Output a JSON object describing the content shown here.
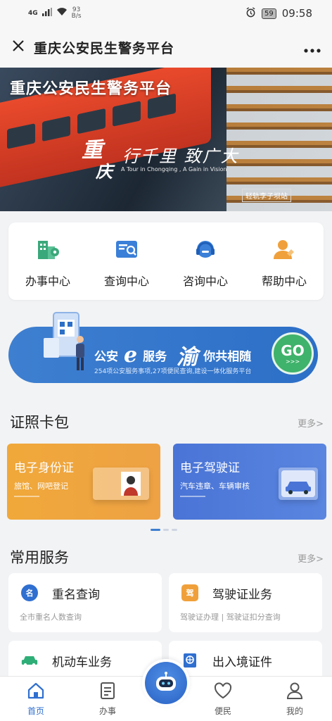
{
  "status": {
    "signal": "4G",
    "net_speed_value": "93",
    "net_speed_unit": "B/s",
    "battery": "59",
    "time": "09:58"
  },
  "navbar": {
    "title": "重庆公安民生警务平台"
  },
  "banner": {
    "title": "重庆公安民生警务平台",
    "calli_1": "重",
    "calli_2": "庆",
    "slogan": "行千里 致广大",
    "slogan_en": "A Tour in Chongqing , A Gain in Vision",
    "station": "轻轨李子坝站"
  },
  "quick": [
    {
      "label": "办事中心",
      "icon": "building-pin-icon",
      "color": "#3aa87a"
    },
    {
      "label": "查询中心",
      "icon": "search-doc-icon",
      "color": "#3a7fd8"
    },
    {
      "label": "咨询中心",
      "icon": "headset-icon",
      "color": "#3a7fd8"
    },
    {
      "label": "帮助中心",
      "icon": "helper-icon",
      "color": "#f0a03a"
    }
  ],
  "promo": {
    "part1": "公安",
    "e": "e",
    "part2": "服务",
    "yu": "渝",
    "part3": "你共相随",
    "sub": "254项公安服务事项,27项便民查询,建设一体化服务平台",
    "go": "GO",
    "go_arrow": ">>>"
  },
  "wallet": {
    "title": "证照卡包",
    "more": "更多>",
    "cards": [
      {
        "title": "电子身份证",
        "subtitle": "旅馆、网吧登记"
      },
      {
        "title": "电子驾驶证",
        "subtitle": "汽车违章、车辆审核"
      }
    ]
  },
  "services": {
    "title": "常用服务",
    "more": "更多>",
    "items": [
      {
        "title": "重名查询",
        "subtitle": "全市重名人数查询",
        "icon_text": "名",
        "color": "#2f6fd0"
      },
      {
        "title": "驾驶证业务",
        "subtitle": "驾驶证办理 | 驾驶证扣分查询",
        "icon_text": "驾",
        "color": "#f0a03a"
      },
      {
        "title": "机动车业务",
        "subtitle": "",
        "icon_text": "",
        "color": "#2fae78"
      },
      {
        "title": "出入境证件",
        "subtitle": "",
        "icon_text": "",
        "color": "#2f6fd0"
      }
    ]
  },
  "tabbar": {
    "home": "首页",
    "affairs": "办事",
    "people": "便民",
    "mine": "我的"
  }
}
